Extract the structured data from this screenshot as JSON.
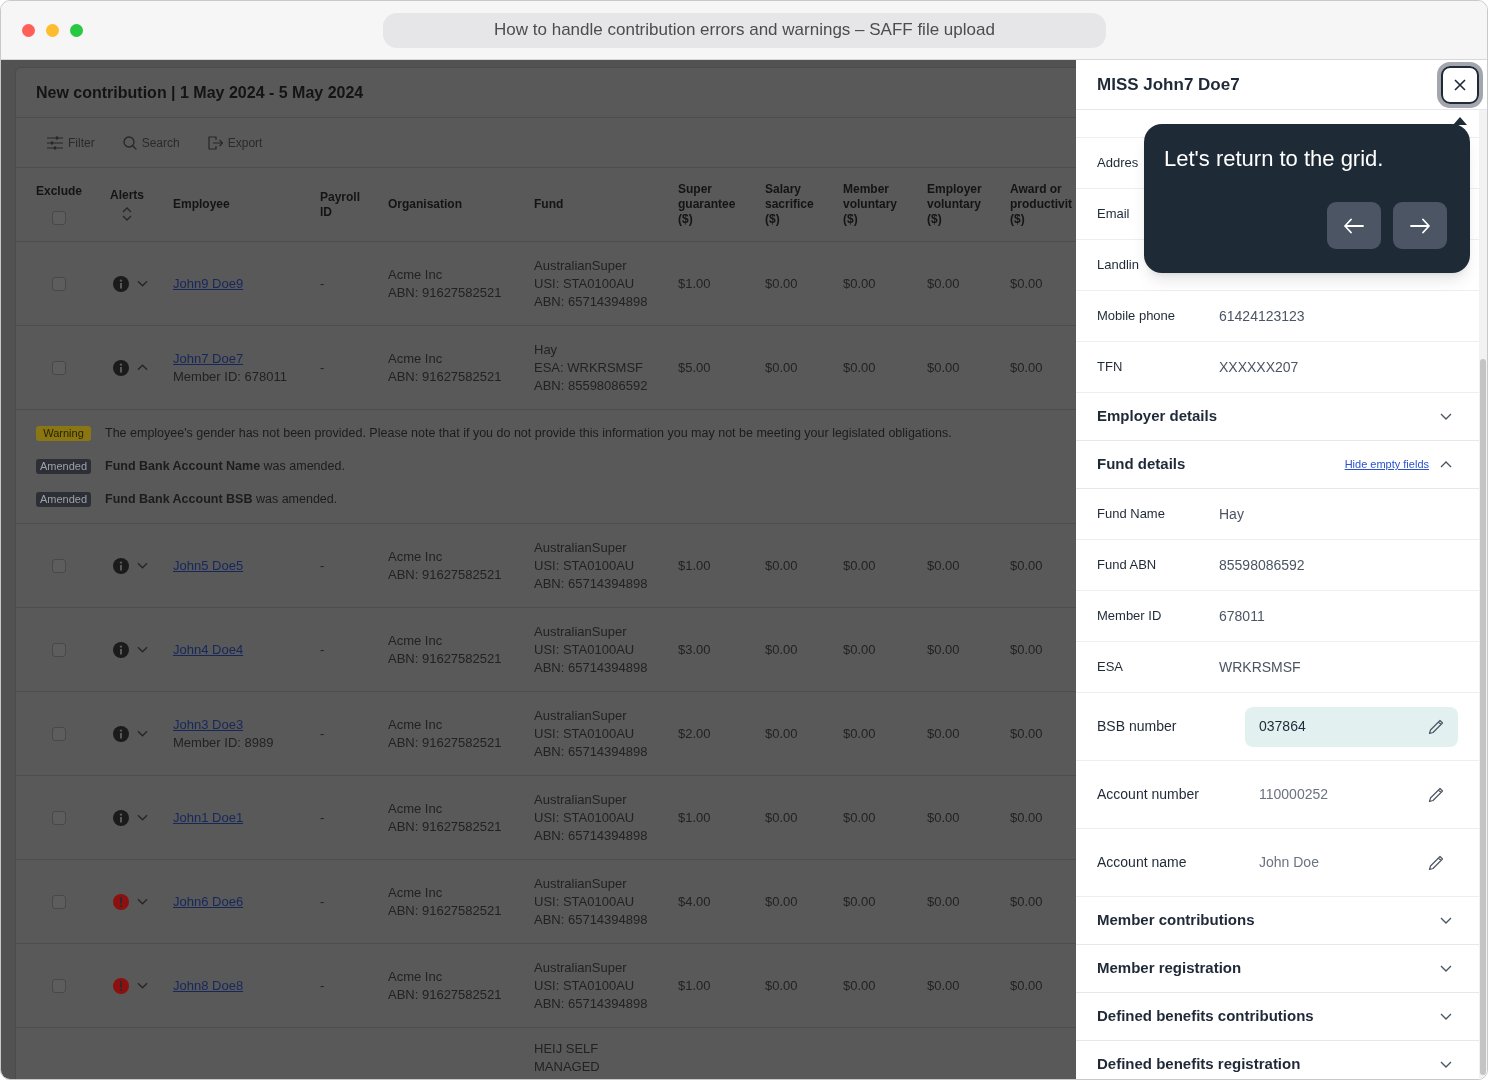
{
  "window": {
    "title": "How to handle contribution errors and warnings – SAFF file upload"
  },
  "contribution": {
    "title": "New contribution | 1 May 2024 - 5 May 2024",
    "toolbar": [
      {
        "kind": "filter",
        "label": "Filter"
      },
      {
        "kind": "search",
        "label": "Search"
      },
      {
        "kind": "export",
        "label": "Export"
      }
    ],
    "table": {
      "exclude_all": false,
      "columns": [
        {
          "kind": "select",
          "label": "Exclude"
        },
        {
          "kind": "sort",
          "label": "Alerts"
        },
        {
          "kind": "text",
          "label": "Employee"
        },
        {
          "kind": "text",
          "label": "Payroll ID"
        },
        {
          "kind": "text",
          "label": "Organisation"
        },
        {
          "kind": "text",
          "label": "Fund"
        },
        {
          "kind": "text",
          "label": "Super guarantee ($)"
        },
        {
          "kind": "text",
          "label": "Salary sacrifice ($)"
        },
        {
          "kind": "text",
          "label": "Member voluntary ($)"
        },
        {
          "kind": "text",
          "label": "Employer voluntary ($)"
        },
        {
          "kind": "text",
          "label": "Award or productivit ($)"
        }
      ],
      "rows": [
        {
          "excluded": false,
          "alert": {
            "kind": "info"
          },
          "expanded": false,
          "employee": "John9 Doe9",
          "payroll_id": "-",
          "organisation": [
            "Acme Inc",
            "ABN: 91627582521"
          ],
          "fund": [
            "AustralianSuper",
            "USI: STA0100AU",
            "ABN: 65714394898"
          ],
          "amounts": [
            "$1.00",
            "$0.00",
            "$0.00",
            "$0.00",
            "$0.00"
          ]
        },
        {
          "excluded": false,
          "alert": {
            "kind": "info"
          },
          "expanded": true,
          "employee": "John7 Doe7",
          "member_id": "Member ID: 678011",
          "payroll_id": "-",
          "organisation": [
            "Acme Inc",
            "ABN: 91627582521"
          ],
          "fund": [
            "Hay",
            "ESA: WRKRSMSF",
            "ABN: 85598086592"
          ],
          "amounts": [
            "$5.00",
            "$0.00",
            "$0.00",
            "$0.00",
            "$0.00"
          ],
          "messages": [
            {
              "kind": "warning",
              "badge": "Warning",
              "text": "The employee's gender has not been provided. Please note that if you do not provide this information you may not be meeting your legislated obligations."
            },
            {
              "kind": "amended",
              "badge": "Amended",
              "text": "**Fund Bank Account Name** was amended."
            },
            {
              "kind": "amended",
              "badge": "Amended",
              "text": "**Fund Bank Account BSB** was amended."
            }
          ]
        },
        {
          "excluded": false,
          "alert": {
            "kind": "info"
          },
          "expanded": false,
          "employee": "John5 Doe5",
          "payroll_id": "-",
          "organisation": [
            "Acme Inc",
            "ABN: 91627582521"
          ],
          "fund": [
            "AustralianSuper",
            "USI: STA0100AU",
            "ABN: 65714394898"
          ],
          "amounts": [
            "$1.00",
            "$0.00",
            "$0.00",
            "$0.00",
            "$0.00"
          ]
        },
        {
          "excluded": false,
          "alert": {
            "kind": "info"
          },
          "expanded": false,
          "employee": "John4 Doe4",
          "payroll_id": "-",
          "organisation": [
            "Acme Inc",
            "ABN: 91627582521"
          ],
          "fund": [
            "AustralianSuper",
            "USI: STA0100AU",
            "ABN: 65714394898"
          ],
          "amounts": [
            "$3.00",
            "$0.00",
            "$0.00",
            "$0.00",
            "$0.00"
          ]
        },
        {
          "excluded": false,
          "alert": {
            "kind": "info"
          },
          "expanded": false,
          "employee": "John3 Doe3",
          "member_id": "Member ID: 8989",
          "payroll_id": "-",
          "organisation": [
            "Acme Inc",
            "ABN: 91627582521"
          ],
          "fund": [
            "AustralianSuper",
            "USI: STA0100AU",
            "ABN: 65714394898"
          ],
          "amounts": [
            "$2.00",
            "$0.00",
            "$0.00",
            "$0.00",
            "$0.00"
          ]
        },
        {
          "excluded": false,
          "alert": {
            "kind": "info"
          },
          "expanded": false,
          "employee": "John1 Doe1",
          "payroll_id": "-",
          "organisation": [
            "Acme Inc",
            "ABN: 91627582521"
          ],
          "fund": [
            "AustralianSuper",
            "USI: STA0100AU",
            "ABN: 65714394898"
          ],
          "amounts": [
            "$1.00",
            "$0.00",
            "$0.00",
            "$0.00",
            "$0.00"
          ]
        },
        {
          "excluded": false,
          "alert": {
            "kind": "error"
          },
          "expanded": false,
          "employee": "John6 Doe6",
          "payroll_id": "-",
          "organisation": [
            "Acme Inc",
            "ABN: 91627582521"
          ],
          "fund": [
            "AustralianSuper",
            "USI: STA0100AU",
            "ABN: 65714394898"
          ],
          "amounts": [
            "$4.00",
            "$0.00",
            "$0.00",
            "$0.00",
            "$0.00"
          ]
        },
        {
          "excluded": false,
          "alert": {
            "kind": "error"
          },
          "expanded": false,
          "employee": "John8 Doe8",
          "payroll_id": "-",
          "organisation": [
            "Acme Inc",
            "ABN: 91627582521"
          ],
          "fund": [
            "AustralianSuper",
            "USI: STA0100AU",
            "ABN: 65714394898"
          ],
          "amounts": [
            "$1.00",
            "$0.00",
            "$0.00",
            "$0.00",
            "$0.00"
          ]
        },
        {
          "fund": [
            "HEIJ SELF",
            "MANAGED"
          ]
        }
      ]
    }
  },
  "details_panel": {
    "title": "MISS John7 Doe7",
    "member_fields": [
      {
        "kind": "text",
        "label": "Addres",
        "highlighted": false
      },
      {
        "kind": "text",
        "label": "Email",
        "highlighted": false
      },
      {
        "kind": "text",
        "label": "Landlin",
        "highlighted": false
      },
      {
        "kind": "text",
        "label": "Mobile phone",
        "value": "61424123123",
        "highlighted": false
      },
      {
        "kind": "text",
        "label": "TFN",
        "value": "XXXXXX207",
        "highlighted": false
      }
    ],
    "sections": [
      {
        "title": "Employer details",
        "expanded": false
      },
      {
        "title": "Fund details",
        "expanded": true,
        "action": "Hide empty fields",
        "fields": [
          {
            "kind": "text",
            "label": "Fund Name",
            "value": "Hay",
            "highlighted": false
          },
          {
            "kind": "text",
            "label": "Fund ABN",
            "value": "85598086592",
            "highlighted": false
          },
          {
            "kind": "text",
            "label": "Member ID",
            "value": "678011",
            "highlighted": false
          },
          {
            "kind": "text",
            "label": "ESA",
            "value": "WRKRSMSF",
            "highlighted": false
          },
          {
            "kind": "editable",
            "label": "BSB number",
            "value": "037864",
            "highlighted": true
          },
          {
            "kind": "editable",
            "label": "Account number",
            "value": "110000252",
            "highlighted": false
          },
          {
            "kind": "editable",
            "label": "Account name",
            "value": "John Doe",
            "highlighted": false
          }
        ]
      },
      {
        "title": "Member contributions",
        "expanded": false
      },
      {
        "title": "Member registration",
        "expanded": false
      },
      {
        "title": "Defined benefits contributions",
        "expanded": false
      },
      {
        "title": "Defined benefits registration",
        "expanded": false
      }
    ]
  },
  "tour_tip": {
    "text": "Let's return to the grid."
  }
}
